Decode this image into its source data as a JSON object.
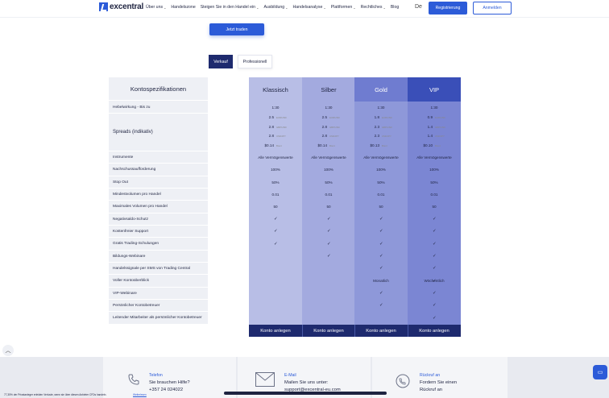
{
  "header": {
    "logo_text": "excentral",
    "nav": [
      {
        "label": "Über uns",
        "has_dropdown": true
      },
      {
        "label": "Handelszone",
        "has_dropdown": false
      },
      {
        "label": "Steigen Sie in den Handel ein",
        "has_dropdown": true
      },
      {
        "label": "Ausbildung",
        "has_dropdown": true
      },
      {
        "label": "Handelsanalyse",
        "has_dropdown": true
      },
      {
        "label": "Plattformen",
        "has_dropdown": true
      },
      {
        "label": "Rechtliches",
        "has_dropdown": true
      },
      {
        "label": "Blog",
        "has_dropdown": false
      }
    ],
    "language": "De",
    "register_label": "Registrierung",
    "login_label": "Anmelden"
  },
  "cta": {
    "trade_label": "Jetzt traden"
  },
  "tabs": {
    "sell": "Verkauf",
    "pro": "Professionell"
  },
  "specs": {
    "title": "Kontospezifikationen",
    "rows": [
      "Hebelwirkung - Bis zu",
      "Spreads (indikativ)",
      "Instrumente",
      "Nachschussaufforderung",
      "Stop Out",
      "Mindestvolumen pro Handel",
      "Maximales Volumen pro Handel",
      "Negativsaldo-Schutz",
      "Kostenfreier Support",
      "Gratis Trading-Schulungen",
      "Bildungs-Webinare",
      "Handelssignale per SMS von Trading Central",
      "Voller Kontoüberblick",
      "VIP-Webinare",
      "Persönlicher Kontobetreuer",
      "Leitender Mitarbeiter als persönlicher Kontobetreuer"
    ]
  },
  "accounts": [
    {
      "name": "Klassisch",
      "head_color": "#b8bee6",
      "head_text": "#1e2340",
      "body_color": "#b8bee6",
      "leverage": "1:30",
      "spreads": [
        {
          "v": "2.5",
          "p": "EUR/USD"
        },
        {
          "v": "2.8",
          "p": "GBP/USD"
        },
        {
          "v": "2.8",
          "p": "USD/JPY"
        },
        {
          "v": "$0.14",
          "p": "Brent"
        }
      ],
      "instruments": "Alle Vermögenswerte",
      "margin_call": "100%",
      "stop_out": "50%",
      "min_volume": "0.01",
      "max_volume": "50",
      "checks": [
        true,
        true,
        true,
        false,
        false,
        false,
        false,
        false,
        false
      ]
    },
    {
      "name": "Silber",
      "head_color": "#a3aadf",
      "head_text": "#1e2340",
      "body_color": "#a3aadf",
      "leverage": "1:30",
      "spreads": [
        {
          "v": "2.5",
          "p": "EUR/USD"
        },
        {
          "v": "2.8",
          "p": "GBP/USD"
        },
        {
          "v": "2.8",
          "p": "USD/JPY"
        },
        {
          "v": "$0.14",
          "p": "Brent"
        }
      ],
      "instruments": "Alle Vermögenswerte",
      "margin_call": "100%",
      "stop_out": "50%",
      "min_volume": "0.01",
      "max_volume": "50",
      "checks": [
        true,
        true,
        true,
        true,
        false,
        false,
        false,
        false,
        false
      ]
    },
    {
      "name": "Gold",
      "head_color": "#6f7cd0",
      "head_text": "#ffffff",
      "body_color": "#8e98d9",
      "leverage": "1:30",
      "spreads": [
        {
          "v": "1.8",
          "p": "EUR/USD"
        },
        {
          "v": "2.3",
          "p": "GBP/USD"
        },
        {
          "v": "2.3",
          "p": "USD/JPY"
        },
        {
          "v": "$0.13",
          "p": "Brent"
        }
      ],
      "instruments": "Alle Vermögenswerte",
      "margin_call": "100%",
      "stop_out": "50%",
      "min_volume": "0.01",
      "max_volume": "50",
      "overview": "Monatlich",
      "checks": [
        true,
        true,
        true,
        true,
        true,
        false,
        true,
        true,
        false
      ]
    },
    {
      "name": "VIP",
      "head_color": "#3a4fb8",
      "head_text": "#ffffff",
      "body_color": "#7b86d3",
      "leverage": "1:30",
      "spreads": [
        {
          "v": "0.9",
          "p": "EUR/USD"
        },
        {
          "v": "1.4",
          "p": "GBP/USD"
        },
        {
          "v": "1.4",
          "p": "USD/JPY"
        },
        {
          "v": "$0.10",
          "p": "Brent"
        }
      ],
      "instruments": "Alle Vermögenswerte",
      "margin_call": "100%",
      "stop_out": "50%",
      "min_volume": "0.01",
      "max_volume": "50",
      "overview": "Wöchentlich",
      "checks": [
        true,
        true,
        true,
        true,
        true,
        true,
        true,
        true,
        true
      ]
    }
  ],
  "open_account_label": "Konto anlegen",
  "footer": {
    "phone_label": "Telefon",
    "phone_line1": "Sie brauchen Hilfe?",
    "phone_line2": "+357 24 024022",
    "email_label": "E-Mail",
    "email_line1": "Mailen Sie uns unter:",
    "email_line2": "support@excentral-eu.com",
    "callback_label": "Rückruf an",
    "callback_line1": "Fordern Sie einen",
    "callback_line2": "Rückruf an",
    "risk_text": "77,35% der Privatanleger erleiden Verluste, wenn sie über diesen Anbieter CFDs handeln.",
    "risk_link": "Weiterlesen"
  }
}
